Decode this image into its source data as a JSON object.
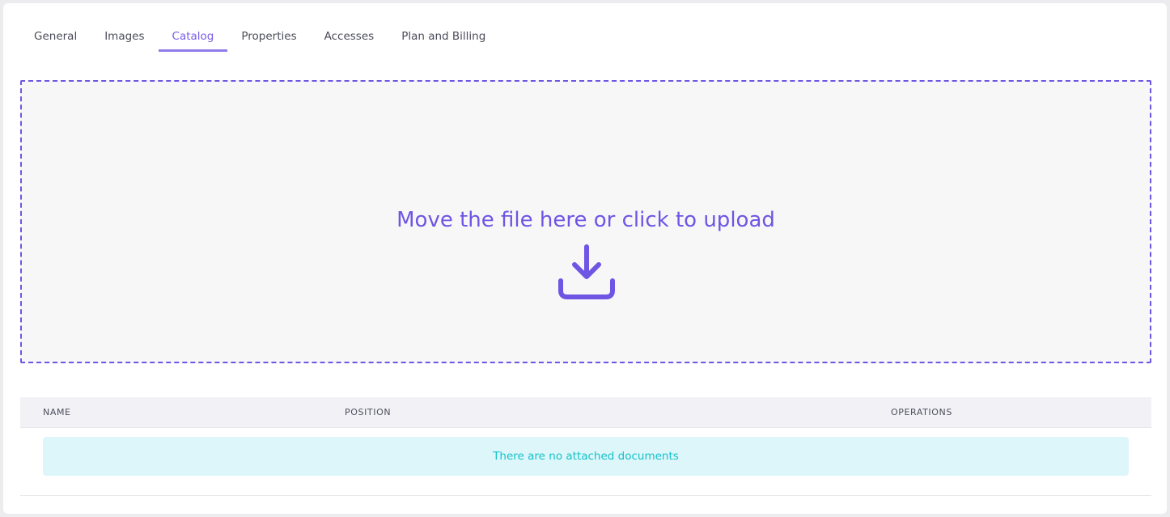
{
  "tabs": [
    {
      "label": "General"
    },
    {
      "label": "Images"
    },
    {
      "label": "Catalog",
      "active": true
    },
    {
      "label": "Properties"
    },
    {
      "label": "Accesses"
    },
    {
      "label": "Plan and Billing"
    }
  ],
  "upload": {
    "prompt": "Move the file here or click to upload",
    "icon": "download-icon"
  },
  "table": {
    "columns": [
      "NAME",
      "POSITION",
      "OPERATIONS"
    ],
    "empty_message": "There are no attached documents"
  },
  "colors": {
    "accent": "#6f55e3",
    "empty_bg": "#ddf6fa",
    "empty_text": "#14c2c9"
  }
}
